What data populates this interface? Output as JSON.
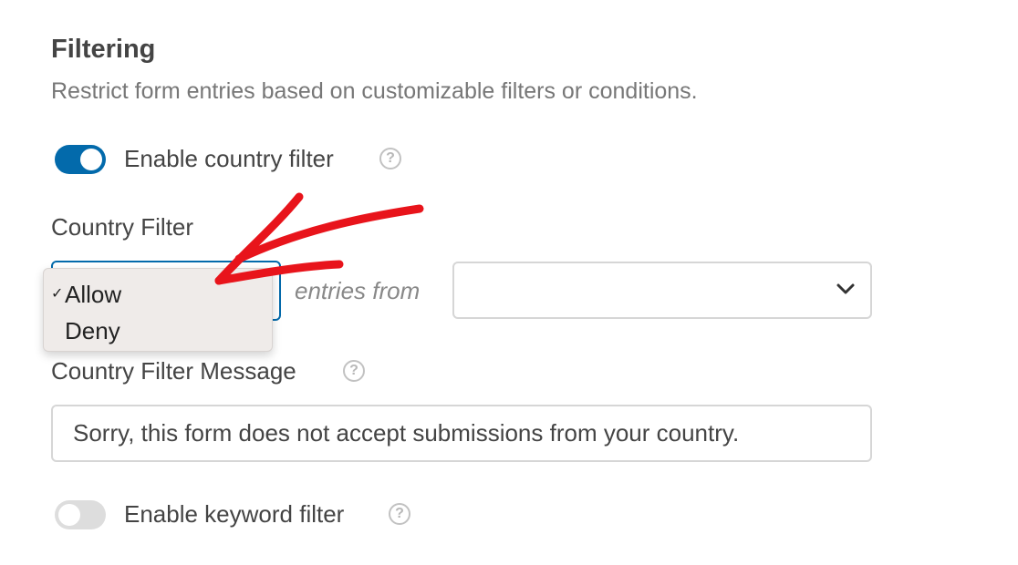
{
  "section": {
    "title": "Filtering",
    "description": "Restrict form entries based on customizable filters or conditions."
  },
  "country_toggle": {
    "label": "Enable country filter",
    "enabled": true,
    "help_icon": "question-mark-circle-icon"
  },
  "country_filter": {
    "label": "Country Filter",
    "options": [
      {
        "label": "Allow",
        "selected": true
      },
      {
        "label": "Deny",
        "selected": false
      }
    ],
    "check_glyph": "✓",
    "connector": "entries from",
    "countries_value": ""
  },
  "message": {
    "label": "Country Filter Message",
    "value": "Sorry, this form does not accept submissions from your country.",
    "help_icon": "question-mark-circle-icon"
  },
  "keyword_toggle": {
    "label": "Enable keyword filter",
    "enabled": false,
    "help_icon": "question-mark-circle-icon"
  },
  "colors": {
    "accent": "#036aab",
    "annotation": "#e8141b"
  }
}
